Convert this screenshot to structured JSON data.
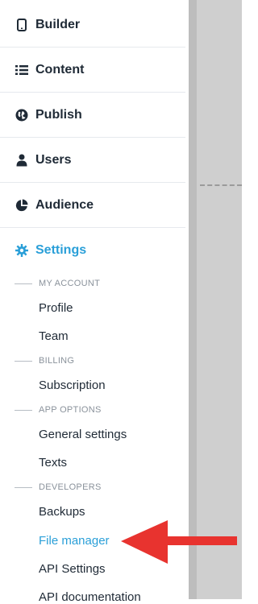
{
  "nav": {
    "items": [
      {
        "label": "Builder",
        "icon": "tablet-icon"
      },
      {
        "label": "Content",
        "icon": "list-icon"
      },
      {
        "label": "Publish",
        "icon": "globe-icon"
      },
      {
        "label": "Users",
        "icon": "user-icon"
      },
      {
        "label": "Audience",
        "icon": "pie-chart-icon"
      },
      {
        "label": "Settings",
        "icon": "gear-icon",
        "active": true
      }
    ]
  },
  "settings": {
    "sections": [
      {
        "heading": "MY ACCOUNT",
        "items": [
          "Profile",
          "Team"
        ]
      },
      {
        "heading": "BILLING",
        "items": [
          "Subscription"
        ]
      },
      {
        "heading": "APP OPTIONS",
        "items": [
          "General settings",
          "Texts"
        ]
      },
      {
        "heading": "DEVELOPERS",
        "items": [
          "Backups",
          "File manager",
          "API Settings",
          "API documentation"
        ]
      }
    ],
    "active_item": "File manager"
  },
  "colors": {
    "accent": "#2a9fd8",
    "text": "#1f2a36",
    "muted": "#8a929b",
    "arrow": "#e8332f",
    "canvas": "#cfcfcf"
  }
}
